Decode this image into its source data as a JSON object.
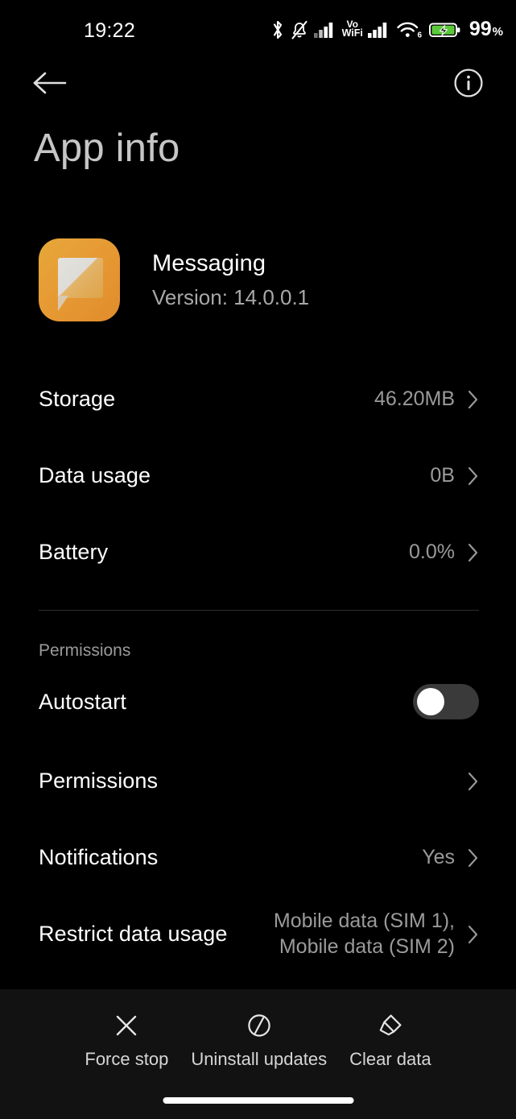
{
  "status_bar": {
    "time": "19:22",
    "battery_percent": "99",
    "percent_sign": "%",
    "vowifi_line1": "Vo",
    "vowifi_line2": "WiFi",
    "wifi_generation": "6",
    "icons": [
      "bluetooth-icon",
      "bell-muted-icon",
      "signal-sim1-icon",
      "vowifi-indicator",
      "signal-sim2-icon",
      "wifi-6-icon",
      "battery-charging-icon"
    ],
    "battery_color": "#5ac93a"
  },
  "nav": {
    "back_label": "back-arrow",
    "info_label": "info"
  },
  "page": {
    "title": "App info"
  },
  "app": {
    "name": "Messaging",
    "version": "Version: 14.0.0.1",
    "icon_color_start": "#e5a83a",
    "icon_color_end": "#e08c2c"
  },
  "rows": [
    {
      "label": "Storage",
      "value": "46.20MB",
      "has_chevron": true
    },
    {
      "label": "Data usage",
      "value": "0B",
      "has_chevron": true
    },
    {
      "label": "Battery",
      "value": "0.0%",
      "has_chevron": true
    }
  ],
  "permissions_section": {
    "header": "Permissions",
    "autostart": {
      "label": "Autostart",
      "state": "off"
    },
    "rows": [
      {
        "label": "Permissions",
        "value": "",
        "has_chevron": true
      },
      {
        "label": "Notifications",
        "value": "Yes",
        "has_chevron": true
      },
      {
        "label": "Restrict data usage",
        "value": "Mobile data (SIM 1),\nMobile data (SIM 2)",
        "has_chevron": true
      }
    ]
  },
  "bottom_actions": [
    {
      "label": "Force stop",
      "icon": "close-x-icon"
    },
    {
      "label": "Uninstall updates",
      "icon": "circle-slash-icon"
    },
    {
      "label": "Clear data",
      "icon": "eraser-icon"
    }
  ]
}
